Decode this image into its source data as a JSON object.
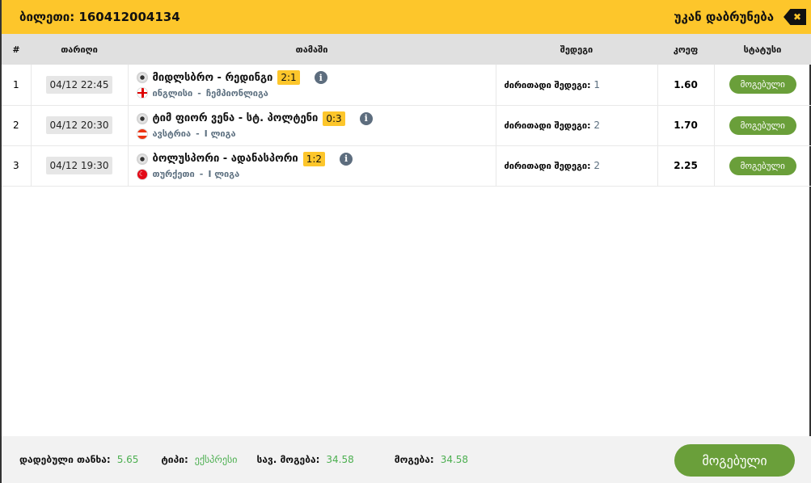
{
  "header": {
    "ticket_label": "ბილეთი: 160412004134",
    "back_label": "უკან დაბრუნება",
    "close_glyph": "✖"
  },
  "columns": [
    "#",
    "თარიღი",
    "თამაში",
    "შედეგი",
    "კოეფ",
    "სტატუსი"
  ],
  "rows": [
    {
      "n": "1",
      "date": "04/12 22:45",
      "match": "მიდლსბრო - რედინგი",
      "score": "2:1",
      "country": "ინგლისი",
      "league": "ჩემპიონლიგა",
      "flag": "england",
      "result_label": "ძირითადი შედეგი:",
      "result": "1",
      "coef": "1.60",
      "status": "მოგებული"
    },
    {
      "n": "2",
      "date": "04/12 20:30",
      "match": "ტიმ ფიორ ვენა - სტ. პოლტენი",
      "score": "0:3",
      "country": "ავსტრია",
      "league": "I ლიგა",
      "flag": "austria",
      "result_label": "ძირითადი შედეგი:",
      "result": "2",
      "coef": "1.70",
      "status": "მოგებული"
    },
    {
      "n": "3",
      "date": "04/12 19:30",
      "match": "ბოლუსპორი - ადანასპორი",
      "score": "1:2",
      "country": "თურქეთი",
      "league": "I ლიგა",
      "flag": "turkey",
      "result_label": "ძირითადი შედეგი:",
      "result": "2",
      "coef": "2.25",
      "status": "მოგებული"
    }
  ],
  "footer": {
    "stake_label": "დადებული თანხა:",
    "stake": "5.65",
    "type_label": "ტიპი:",
    "type": "ექსპრესი",
    "max_win_label": "სავ. მოგება:",
    "max_win": "34.58",
    "win_label": "მოგება:",
    "win": "34.58",
    "status_button": "მოგებული"
  },
  "colors": {
    "accent": "#fdc62b",
    "green": "#6a9f3a"
  }
}
